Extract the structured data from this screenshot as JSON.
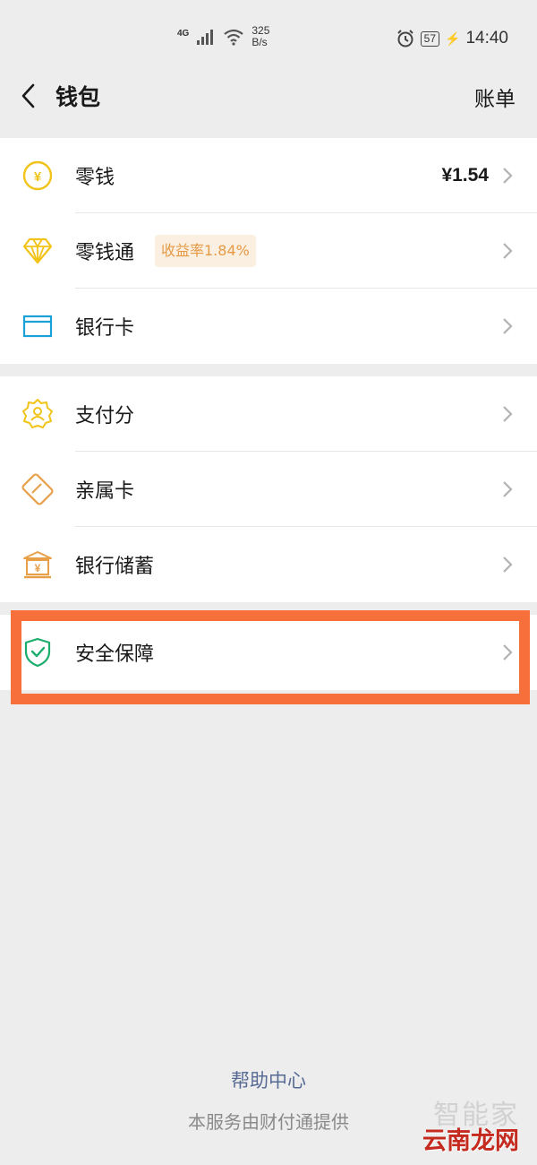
{
  "status_bar": {
    "net_type": "4G",
    "net_speed_value": "325",
    "net_speed_unit": "B/s",
    "battery": "57",
    "time": "14:40",
    "icons": [
      "signal-icon",
      "wifi-icon",
      "alarm-icon",
      "battery-icon",
      "charging-icon"
    ]
  },
  "header": {
    "title": "钱包",
    "right_link": "账单"
  },
  "group1": {
    "items": [
      {
        "label": "零钱",
        "value": "¥1.54",
        "icon": "coin-icon",
        "icon_color": "#f2c41a"
      },
      {
        "label": "零钱通",
        "badge": "收益率1.84%",
        "icon": "diamond-icon",
        "icon_color": "#f2c41a"
      },
      {
        "label": "银行卡",
        "icon": "bank-card-icon",
        "icon_color": "#1aa1d8"
      }
    ]
  },
  "group2": {
    "items": [
      {
        "label": "支付分",
        "icon": "score-badge-icon",
        "icon_color": "#f2c41a"
      },
      {
        "label": "亲属卡",
        "icon": "family-card-icon",
        "icon_color": "#e8a048"
      },
      {
        "label": "银行储蓄",
        "icon": "bank-building-icon",
        "icon_color": "#e8a048"
      }
    ]
  },
  "group3": {
    "items": [
      {
        "label": "安全保障",
        "icon": "shield-check-icon",
        "icon_color": "#1aad6b"
      }
    ]
  },
  "footer": {
    "help": "帮助中心",
    "note": "本服务由财付通提供"
  },
  "watermark": {
    "top": "智能家",
    "bottom": "云南龙网"
  },
  "colors": {
    "highlight": "#f7703c",
    "link": "#576b95",
    "background": "#ededed"
  }
}
